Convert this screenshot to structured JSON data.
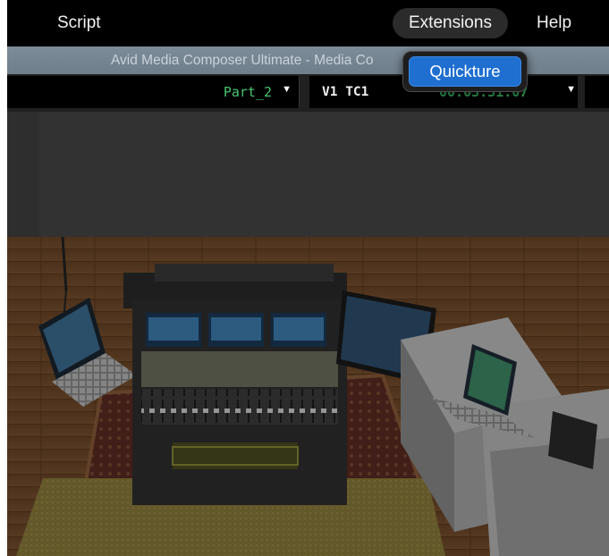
{
  "menubar": {
    "items": [
      {
        "label": "Script"
      },
      {
        "label": "Extensions"
      },
      {
        "label": "Help"
      }
    ]
  },
  "window": {
    "title": "Avid Media Composer Ultimate - Media Co"
  },
  "timeline": {
    "sequence_name": "Part_2",
    "track": "V1  TC1",
    "timecode": "00:03:31:07",
    "dropdown_glyph": "▼"
  },
  "extensions_menu": {
    "items": [
      {
        "label": "Quickture"
      }
    ]
  },
  "colors": {
    "menu_bg": "#000000",
    "titlebar": "#7a8996",
    "timecode_green": "#35a85a",
    "selection_blue": "#1f6fd0"
  }
}
